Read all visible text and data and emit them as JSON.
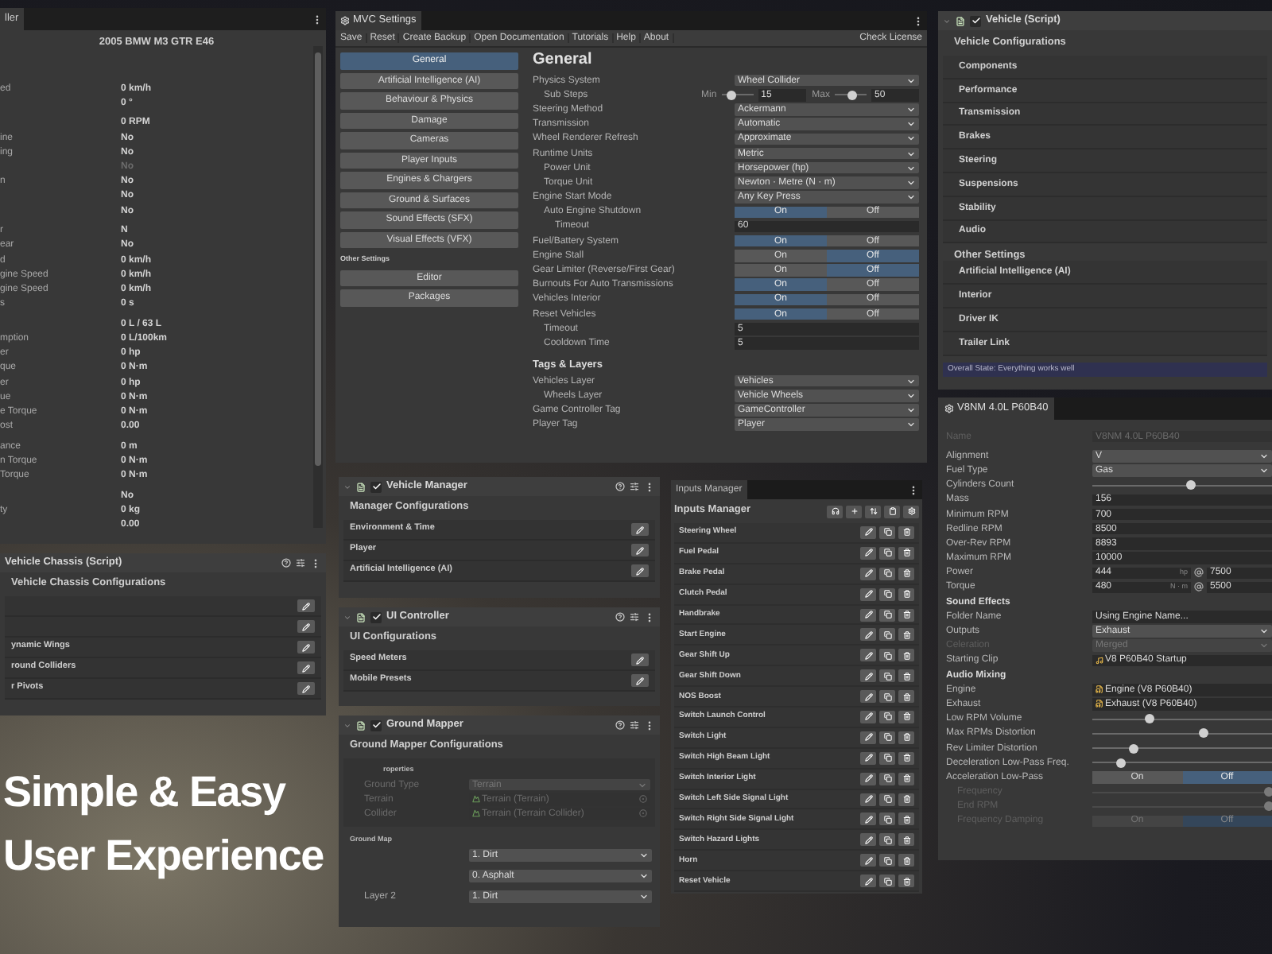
{
  "stats_panel": {
    "tab": "ller",
    "title": "2005 BMW M3 GTR E46",
    "groups": [
      [
        {
          "label": "ed",
          "value": "0 km/h",
          "dim": false
        },
        {
          "value": "0 °",
          "dim": false
        }
      ],
      [
        {
          "value": "0 RPM",
          "dim": false
        },
        {
          "label": "ine",
          "value": "No",
          "dim": false
        },
        {
          "label": "ing",
          "value": "No",
          "dim": false
        },
        {
          "value": "No",
          "dim": true
        },
        {
          "label": "n",
          "value": "No",
          "dim": false
        },
        {
          "value": "No",
          "dim": false
        },
        {
          "value": "No",
          "dim": false
        }
      ],
      [
        {
          "label": "r",
          "value": "N",
          "dim": false
        },
        {
          "label": "ear",
          "value": "No",
          "dim": false
        },
        {
          "label": "d",
          "value": "0 km/h",
          "dim": false
        },
        {
          "label": "gine Speed",
          "value": "0 km/h",
          "dim": false
        },
        {
          "label": "gine Speed",
          "value": "0 km/h",
          "dim": false
        },
        {
          "label": "s",
          "value": "0 s",
          "dim": false
        }
      ],
      [
        {
          "value": "0 L / 63 L",
          "dim": false
        },
        {
          "label": "mption",
          "value": "0 L/100km",
          "dim": false
        },
        {
          "label": "er",
          "value": "0 hp",
          "dim": false
        },
        {
          "label": "que",
          "value": "0 N·m",
          "dim": false
        },
        {
          "label": "er",
          "value": "0 hp",
          "dim": false
        },
        {
          "label": "ue",
          "value": "0 N·m",
          "dim": false
        },
        {
          "label": "e Torque",
          "value": "0 N·m",
          "dim": false
        },
        {
          "label": "ost",
          "value": "0.00",
          "dim": false
        }
      ],
      [
        {
          "label": "ance",
          "value": "0 m",
          "dim": false
        },
        {
          "label": "n Torque",
          "value": "0 N·m",
          "dim": false
        },
        {
          "label": "Torque",
          "value": "0 N·m",
          "dim": false
        }
      ],
      [
        {
          "value": "No",
          "dim": false
        },
        {
          "label": "ty",
          "value": "0 kg",
          "dim": false
        },
        {
          "value": "0.00",
          "dim": false
        }
      ]
    ]
  },
  "settings_window": {
    "tab": "MVC Settings",
    "menu": [
      "Save",
      "Reset",
      "Create Backup",
      "Open Documentation",
      "Tutorials",
      "Help",
      "About"
    ],
    "menu_right": "Check License",
    "sidebar": [
      {
        "label": "General",
        "selected": true
      },
      {
        "label": "Artificial Intelligence (AI)",
        "selected": false
      },
      {
        "label": "Behaviour & Physics",
        "selected": false
      },
      {
        "label": "Damage",
        "selected": false
      },
      {
        "label": "Cameras",
        "selected": false
      },
      {
        "label": "Player Inputs",
        "selected": false
      },
      {
        "label": "Engines & Chargers",
        "selected": false
      },
      {
        "label": "Ground & Surfaces",
        "selected": false
      },
      {
        "label": "Sound Effects (SFX)",
        "selected": false
      },
      {
        "label": "Visual Effects (VFX)",
        "selected": false
      }
    ],
    "sidebar_other_title": "Other Settings",
    "sidebar_other": [
      {
        "label": "Editor",
        "selected": false
      },
      {
        "label": "Packages",
        "selected": false
      }
    ],
    "page_title": "General",
    "sections": [
      {
        "rows": [
          {
            "kind": "dropdown",
            "label": "Physics System",
            "value": "Wheel Collider",
            "children": [
              {
                "kind": "range",
                "label": "Sub Steps",
                "parts": [
                  {
                    "label": "Min",
                    "level": 0.3,
                    "value": "15"
                  },
                  {
                    "label": "Max",
                    "level": 0.55,
                    "value": "50"
                  }
                ]
              }
            ]
          },
          {
            "kind": "dropdown",
            "label": "Steering Method",
            "value": "Ackermann"
          },
          {
            "kind": "dropdown",
            "label": "Transmission",
            "value": "Automatic"
          },
          {
            "kind": "dropdown",
            "label": "Wheel Renderer Refresh",
            "value": "Approximate"
          },
          {
            "kind": "dropdown",
            "label": "Runtime Units",
            "value": "Metric",
            "children": [
              {
                "kind": "dropdown",
                "label": "Power Unit",
                "value": "Horsepower (hp)"
              },
              {
                "kind": "dropdown",
                "label": "Torque Unit",
                "value": "Newton · Metre (N · m)"
              }
            ]
          },
          {
            "kind": "dropdown",
            "label": "Engine Start Mode",
            "value": "Any Key Press",
            "children": [
              {
                "kind": "toggle",
                "label": "Auto Engine Shutdown",
                "options": [
                  {
                    "label": "On",
                    "selected": true
                  },
                  {
                    "label": "Off",
                    "selected": false
                  }
                ],
                "children": [
                  {
                    "kind": "number",
                    "label": "Timeout",
                    "value": "60"
                  }
                ]
              }
            ]
          },
          {
            "kind": "toggle",
            "label": "Fuel/Battery System",
            "options": [
              {
                "label": "On",
                "selected": true
              },
              {
                "label": "Off",
                "selected": false
              }
            ]
          },
          {
            "kind": "toggle",
            "label": "Engine Stall",
            "options": [
              {
                "label": "On",
                "selected": false
              },
              {
                "label": "Off",
                "selected": true
              }
            ]
          },
          {
            "kind": "toggle",
            "label": "Gear Limiter (Reverse/First Gear)",
            "options": [
              {
                "label": "On",
                "selected": false
              },
              {
                "label": "Off",
                "selected": true
              }
            ]
          },
          {
            "kind": "toggle",
            "label": "Burnouts For Auto Transmissions",
            "options": [
              {
                "label": "On",
                "selected": true
              },
              {
                "label": "Off",
                "selected": false
              }
            ]
          },
          {
            "kind": "toggle",
            "label": "Vehicles Interior",
            "options": [
              {
                "label": "On",
                "selected": true
              },
              {
                "label": "Off",
                "selected": false
              }
            ]
          },
          {
            "kind": "toggle",
            "label": "Reset Vehicles",
            "options": [
              {
                "label": "On",
                "selected": true
              },
              {
                "label": "Off",
                "selected": false
              }
            ],
            "children": [
              {
                "kind": "number",
                "label": "Timeout",
                "value": "5"
              },
              {
                "kind": "number",
                "label": "Cooldown Time",
                "value": "5"
              }
            ]
          }
        ]
      },
      {
        "title": "Tags & Layers",
        "rows": [
          {
            "kind": "dropdown",
            "label": "Vehicles Layer",
            "value": "Vehicles",
            "children": [
              {
                "kind": "dropdown",
                "label": "Wheels Layer",
                "value": "Vehicle Wheels"
              }
            ]
          },
          {
            "kind": "dropdown",
            "label": "Game Controller Tag",
            "value": "GameController"
          },
          {
            "kind": "dropdown",
            "label": "Player Tag",
            "value": "Player"
          }
        ]
      }
    ]
  },
  "vehicle_script": {
    "title": "Vehicle (Script)",
    "checked": true,
    "heading": "Vehicle Configurations",
    "items": [
      "Components",
      "Performance",
      "Transmission",
      "Brakes",
      "Steering",
      "Suspensions",
      "Stability",
      "Audio"
    ],
    "other_title": "Other Settings",
    "other_items": [
      "Artificial Intelligence (AI)",
      "Interior",
      "Driver IK",
      "Trailer Link"
    ],
    "status": "Overall State: Everything works well"
  },
  "engine_panel": {
    "tab": "V8NM 4.0L P60B40",
    "rows": [
      {
        "kind": "field",
        "label": "Name",
        "value": "V8NM 4.0L P60B40",
        "disabled": true
      },
      {
        "kind": "dropdown",
        "label": "Alignment",
        "value": "V",
        "disabled": false
      },
      {
        "kind": "dropdown",
        "label": "Fuel Type",
        "value": "Gas",
        "disabled": false
      },
      {
        "kind": "slider",
        "label": "Cylinders Count",
        "level": 0.55,
        "disabled": false
      },
      {
        "kind": "field",
        "label": "Mass",
        "value": "156",
        "disabled": false
      },
      {
        "kind": "field",
        "label": "Minimum RPM",
        "value": "700",
        "disabled": false
      },
      {
        "kind": "field",
        "label": "Redline RPM",
        "value": "8500",
        "disabled": false
      },
      {
        "kind": "field",
        "label": "Over-Rev RPM",
        "value": "8893",
        "disabled": false
      },
      {
        "kind": "field",
        "label": "Maximum RPM",
        "value": "10000",
        "disabled": false
      },
      {
        "kind": "power",
        "label": "Power",
        "value": "444",
        "unit": "hp",
        "rpm": "7500",
        "disabled": false
      },
      {
        "kind": "power",
        "label": "Torque",
        "value": "480",
        "unit": "N · m",
        "rpm": "5500",
        "disabled": false
      },
      {
        "kind": "heading",
        "label": "Sound Effects"
      },
      {
        "kind": "field",
        "label": "Folder Name",
        "value": "Using Engine Name...",
        "disabled": false
      },
      {
        "kind": "dropdown",
        "label": "Outputs",
        "value": "Exhaust",
        "disabled": false
      },
      {
        "kind": "dropdown",
        "label": "Celeration",
        "value": "Merged",
        "disabled": true
      },
      {
        "kind": "object",
        "label": "Starting Clip",
        "value": "V8 P60B40 Startup",
        "disabled": false
      },
      {
        "kind": "heading",
        "label": "Audio Mixing"
      },
      {
        "kind": "object",
        "label": "Engine",
        "value": "Engine (V8 P60B40)",
        "disabled": false
      },
      {
        "kind": "object",
        "label": "Exhaust",
        "value": "Exhaust (V8 P60B40)",
        "disabled": false
      },
      {
        "kind": "slider",
        "label": "Low RPM Volume",
        "level": 0.32,
        "disabled": false
      },
      {
        "kind": "slider",
        "label": "Max RPMs Distortion",
        "level": 0.62,
        "disabled": false
      },
      {
        "kind": "slider",
        "label": "Rev Limiter Distortion",
        "level": 0.23,
        "disabled": false
      },
      {
        "kind": "slider",
        "label": "Deceleration Low-Pass Freq.",
        "level": 0.16,
        "disabled": false
      },
      {
        "kind": "toggle",
        "label": "Acceleration Low-Pass",
        "options": [
          {
            "label": "On",
            "selected": false
          },
          {
            "label": "Off",
            "selected": true
          }
        ],
        "disabled": false,
        "children": [
          {
            "kind": "slider",
            "label": "Frequency",
            "level": 0.98,
            "disabled": true
          },
          {
            "kind": "slider",
            "label": "End RPM",
            "level": 0.98,
            "disabled": true
          },
          {
            "kind": "toggle",
            "label": "Frequency Damping",
            "options": [
              {
                "label": "On",
                "selected": false
              },
              {
                "label": "Off",
                "selected": true
              }
            ],
            "disabled": true
          }
        ]
      }
    ]
  },
  "vehicle_manager": {
    "title": "Vehicle Manager",
    "checked": true,
    "heading": "Manager Configurations",
    "items": [
      {
        "kind": "editable",
        "label": "Environment & Time"
      },
      {
        "kind": "editable",
        "label": "Player"
      },
      {
        "kind": "editable",
        "label": "Artificial Intelligence (AI)"
      }
    ]
  },
  "ui_controller": {
    "title": "UI Controller",
    "checked": true,
    "heading": "UI Configurations",
    "items": [
      {
        "kind": "editable",
        "label": "Speed Meters"
      },
      {
        "kind": "editable",
        "label": "Mobile Presets"
      }
    ]
  },
  "vehicle_chassis": {
    "title": "Vehicle Chassis (Script)",
    "heading": "Vehicle Chassis Configurations",
    "items": [
      {
        "kind": "editable"
      },
      {
        "kind": "editable"
      },
      {
        "kind": "editable",
        "label": "ynamic Wings"
      },
      {
        "kind": "editable",
        "label": "round Colliders"
      },
      {
        "kind": "editable",
        "label": "r Pivots"
      }
    ]
  },
  "ground_mapper": {
    "title": "Ground Mapper",
    "checked": true,
    "heading": "Ground Mapper Configurations",
    "properties_title": "roperties",
    "properties": [
      {
        "kind": "dropdown",
        "label": "Ground Type",
        "value": "Terrain"
      },
      {
        "kind": "object",
        "label": "Terrain",
        "value": "Terrain (Terrain)"
      },
      {
        "kind": "object",
        "label": "Collider",
        "value": "Terrain (Terrain Collider)"
      }
    ],
    "map_title": "Ground Map",
    "layers": [
      {
        "value": "1. Dirt"
      },
      {
        "value": "0. Asphalt"
      },
      {
        "label": "Layer 2",
        "value": "1. Dirt"
      }
    ]
  },
  "inputs_manager": {
    "tab": "Inputs Manager",
    "title": "Inputs Manager",
    "inputs": [
      "Steering Wheel",
      "Fuel Pedal",
      "Brake Pedal",
      "Clutch Pedal",
      "Handbrake",
      "Start Engine",
      "Gear Shift Up",
      "Gear Shift Down",
      "NOS Boost",
      "Switch Launch Control",
      "Switch Light",
      "Switch High Beam Light",
      "Switch Interior Light",
      "Switch Left Side Signal Light",
      "Switch Right Side Signal Light",
      "Switch Hazard Lights",
      "Horn",
      "Reset Vehicle"
    ]
  },
  "headline": [
    "Simple & Easy",
    "User Experience"
  ]
}
